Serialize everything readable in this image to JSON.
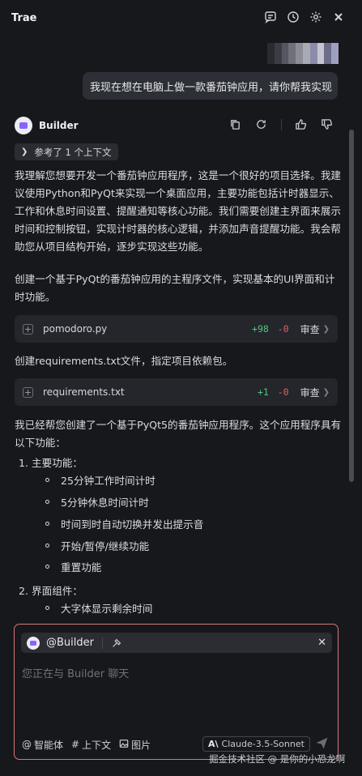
{
  "app": {
    "title": "Trae"
  },
  "user_message": "我现在想在电脑上做一款番茄钟应用，请你帮我实现",
  "bot": {
    "name": "Builder"
  },
  "context_chip": "参考了 1 个上下文",
  "paragraphs": {
    "p1": "我理解您想要开发一个番茄钟应用程序，这是一个很好的项目选择。我建议使用Python和PyQt来实现一个桌面应用，主要功能包括计时器显示、工作和休息时间设置、提醒通知等核心功能。我们需要创建主界面来展示时间和控制按钮，实现计时器的核心逻辑，并添加声音提醒功能。我会帮助您从项目结构开始，逐步实现这些功能。",
    "p2": "创建一个基于PyQt的番茄钟应用的主程序文件，实现基本的UI界面和计时功能。",
    "p3": "创建requirements.txt文件，指定项目依赖包。",
    "p4": "我已经帮您创建了一个基于PyQt5的番茄钟应用程序。这个应用程序具有以下功能："
  },
  "files": [
    {
      "name": "pomodoro.py",
      "add": "+98",
      "del": "-0",
      "action": "审查"
    },
    {
      "name": "requirements.txt",
      "add": "+1",
      "del": "-0",
      "action": "审查"
    }
  ],
  "list": {
    "item1": "1. 主要功能：",
    "item1_bullets": [
      "25分钟工作时间计时",
      "5分钟休息时间计时",
      "时间到时自动切换并发出提示音",
      "开始/暂停/继续功能",
      "重置功能"
    ],
    "item2": "2. 界面组件：",
    "item2_bullets": [
      "大字体显示剩余时间"
    ]
  },
  "chat_input": {
    "mention": "@Builder",
    "placeholder": "您正在与 Builder 聊天",
    "agent_label": "智能体",
    "context_label": "上下文",
    "image_label": "图片",
    "model_name": "Claude-3.5-Sonnet"
  },
  "watermark": "掘金技术社区 @ 是你的小恐龙啊",
  "colors": {
    "accent": "#8a63ff",
    "add": "#56c27a",
    "del": "#e06262",
    "input_border": "#d77878"
  }
}
